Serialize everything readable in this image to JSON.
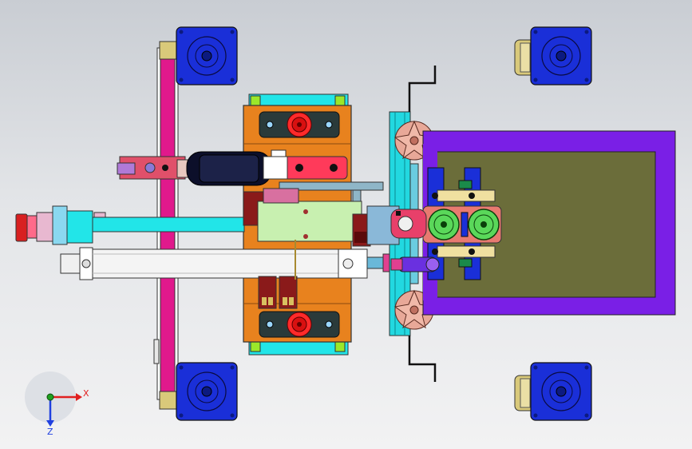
{
  "colors": {
    "motor_blue": "#1a2fd8",
    "orange_block": "#e8821e",
    "cyan_frame": "#22e5e8",
    "magenta_rail": "#e0198c",
    "purple_tray": "#7a1fe6",
    "olive_tray": "#6b6d3a",
    "axis_x": "#e02020",
    "axis_y": "#20a020",
    "axis_z": "#2040e0"
  },
  "triad": {
    "x_label": "X",
    "z_label": "Z"
  }
}
